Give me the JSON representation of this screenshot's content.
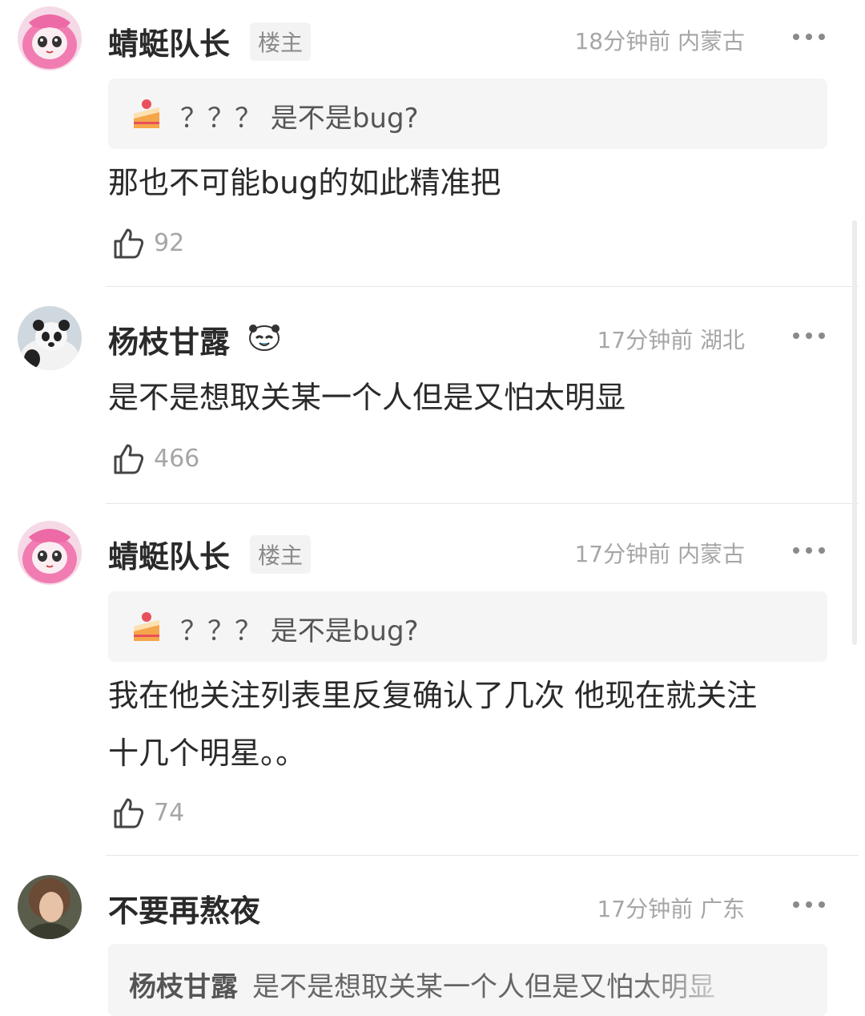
{
  "comments": [
    {
      "name": "蜻蜓队长",
      "badge": "楼主",
      "meta": "18分钟前 内蒙古",
      "quote": "？？？ 是不是bug?",
      "text": [
        "那也不可能bug的如此精准把"
      ],
      "likes": "92"
    },
    {
      "name": "杨枝甘露",
      "badge": "",
      "meta": "17分钟前 湖北",
      "text": [
        "是不是想取关某一个人但是又怕太明显"
      ],
      "likes": "466"
    },
    {
      "name": "蜻蜓队长",
      "badge": "楼主",
      "meta": "17分钟前 内蒙古",
      "quote": "？？？ 是不是bug?",
      "text": [
        "我在他关注列表里反复确认了几次 他现在就关注",
        "十几个明星。。"
      ],
      "likes": "74"
    },
    {
      "name": "不要再熬夜",
      "meta": "17分钟前 广东",
      "reply_name": "杨枝甘露",
      "reply_text": "是不是想取关某一个人但是又怕太明显"
    }
  ],
  "icons": {
    "more": "more-dots-icon",
    "like": "thumbs-up-icon",
    "quote": "cake-emoji-icon",
    "emoji": "panda-emoji-icon"
  },
  "colors": {
    "meta": "#a6a6a6",
    "text": "#2a2a2a",
    "quote_bg": "#f5f5f5"
  }
}
